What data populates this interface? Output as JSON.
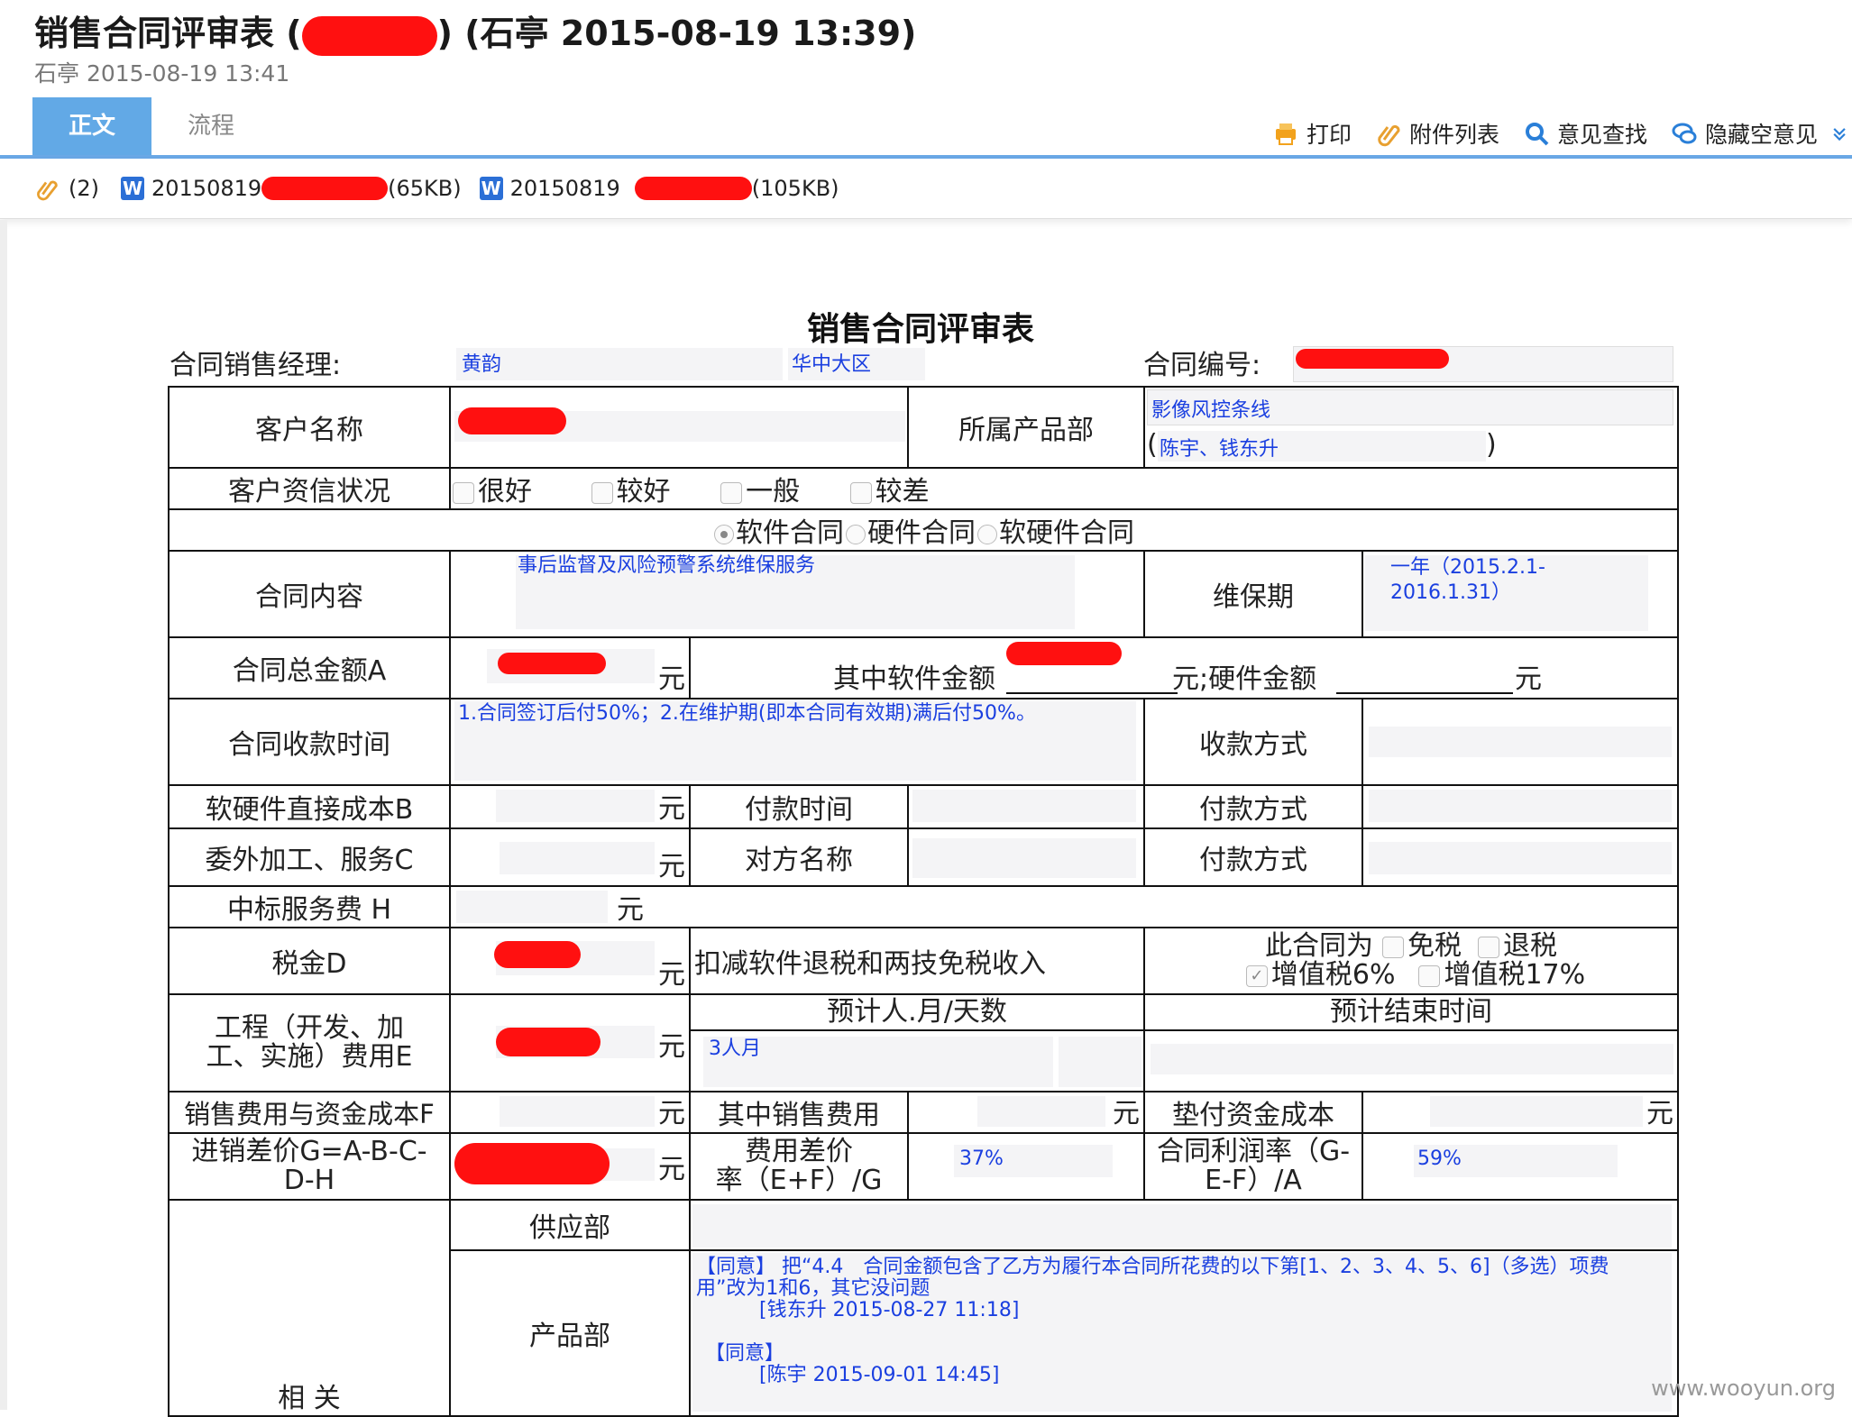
{
  "header": {
    "title_prefix": "销售合同评审表 (",
    "title_suffix": ") (石亭 2015-08-19 13:39)",
    "meta": "石亭 2015-08-19 13:41"
  },
  "tabs": [
    {
      "label": "正文"
    },
    {
      "label": "流程"
    }
  ],
  "toolbar": {
    "print": "打印",
    "attachments": "附件列表",
    "find_opinion": "意见查找",
    "hide_empty": "隐藏空意见"
  },
  "attachments": {
    "count": "(2)",
    "files": [
      {
        "name_start": "20150819",
        "size": "(65KB)"
      },
      {
        "name_start": "20150819",
        "size": "(105KB)"
      }
    ]
  },
  "form": {
    "title": "销售合同评审表",
    "manager_label": "合同销售经理:",
    "manager_value": "黄韵",
    "region_value": "华中大区",
    "contract_no_label": "合同编号:",
    "customer_name_label": "客户名称",
    "product_dept_label": "所属产品部",
    "product_line_value": "影像风控条线",
    "product_people_open": "(",
    "product_people_value": "陈宇、钱东升",
    "product_people_close": ")",
    "credit_label": "客户资信状况",
    "credit_options": [
      "很好",
      "较好",
      "一般",
      "较差"
    ],
    "contract_types": [
      "软件合同",
      "硬件合同",
      "软硬件合同"
    ],
    "content_label": "合同内容",
    "content_value": "事后监督及风险预警系统维保服务",
    "maintenance_label": "维保期",
    "maintenance_value": "一年（2015.2.1-2016.1.31）",
    "total_label": "合同总金额A",
    "yuan": "元",
    "software_amount_label": "其中软件金额",
    "hardware_amount_label": "元;硬件金额",
    "receipt_time_label": "合同收款时间",
    "receipt_time_value": "1.合同签订后付50%；2.在维护期(即本合同有效期)满后付50%。",
    "receipt_method_label": "收款方式",
    "cost_b_label": "软硬件直接成本B",
    "pay_time_label": "付款时间",
    "pay_method_label": "付款方式",
    "cost_c_label": "委外加工、服务C",
    "counterparty_label": "对方名称",
    "fee_h_label": "中标服务费 H",
    "tax_label": "税金D",
    "tax_deduct_label": "扣减软件退税和两技免税收入",
    "tax_type_label": "此合同为",
    "tax_options": [
      "免税",
      "退税",
      "增值税6%",
      "增值税17%"
    ],
    "man_days_label": "预计人.月/天数",
    "end_time_label": "预计结束时间",
    "eng_label_1": "工程（开发、加",
    "eng_label_2": "工、实施）费用E",
    "man_days_value": "3人月",
    "sales_f_label": "销售费用与资金成本F",
    "sales_fee_label": "其中销售费用",
    "advance_label": "垫付资金成本",
    "margin_label_1": "进销差价G=A-B-C-",
    "margin_label_2": "D-H",
    "fee_ratio_label_1": "费用差价",
    "fee_ratio_label_2": "率（E+F）/G",
    "fee_ratio_value": "37%",
    "profit_label_1": "合同利润率（G-",
    "profit_label_2": "E-F）/A",
    "profit_value": "59%",
    "related_label": "相 关",
    "supply_label": "供应部",
    "product_label": "产品部",
    "opinion1_tag": "【同意】",
    "opinion1_text": "把“4.4　合同金额包含了乙方为履行本合同所花费的以下第[1、2、3、4、5、6]（多选）项费用”改为1和6，其它没问题",
    "opinion1_sign": "[钱东升 2015-08-27 11:18]",
    "opinion2_tag": "【同意】",
    "opinion2_sign": "[陈宇 2015-09-01 14:45]"
  },
  "watermark": "www.wooyun.org"
}
